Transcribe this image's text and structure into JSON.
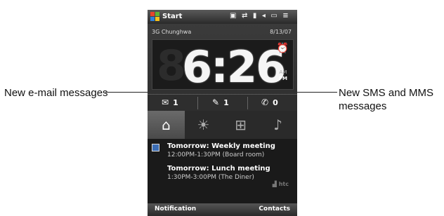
{
  "callouts": {
    "left": "New e-mail messages",
    "right_line1": "New SMS and MMS",
    "right_line2": "messages"
  },
  "titlebar": {
    "title": "Start",
    "icons": [
      "network-icon",
      "sync-icon",
      "signal-icon",
      "volume-icon",
      "battery-icon",
      "menu-icon"
    ]
  },
  "home": {
    "carrier": "3G Chunghwa",
    "date": "8/13/07",
    "ghost_digit": "8",
    "time": "6:26",
    "am": "AM",
    "pm": "PM"
  },
  "counts": {
    "email": "1",
    "sms": "1",
    "calls": "0"
  },
  "tabs": [
    {
      "name": "home",
      "active": true
    },
    {
      "name": "weather",
      "active": false
    },
    {
      "name": "launcher",
      "active": false
    },
    {
      "name": "music",
      "active": false
    }
  ],
  "appointments": [
    {
      "title": "Tomorrow: Weekly meeting",
      "time": "12:00PM-1:30PM (Board room)"
    },
    {
      "title": "Tomorrow: Lunch meeting",
      "time": "1:30PM-3:00PM (The Diner)"
    }
  ],
  "logo": "htc",
  "softkeys": {
    "left": "Notification",
    "right": "Contacts"
  }
}
